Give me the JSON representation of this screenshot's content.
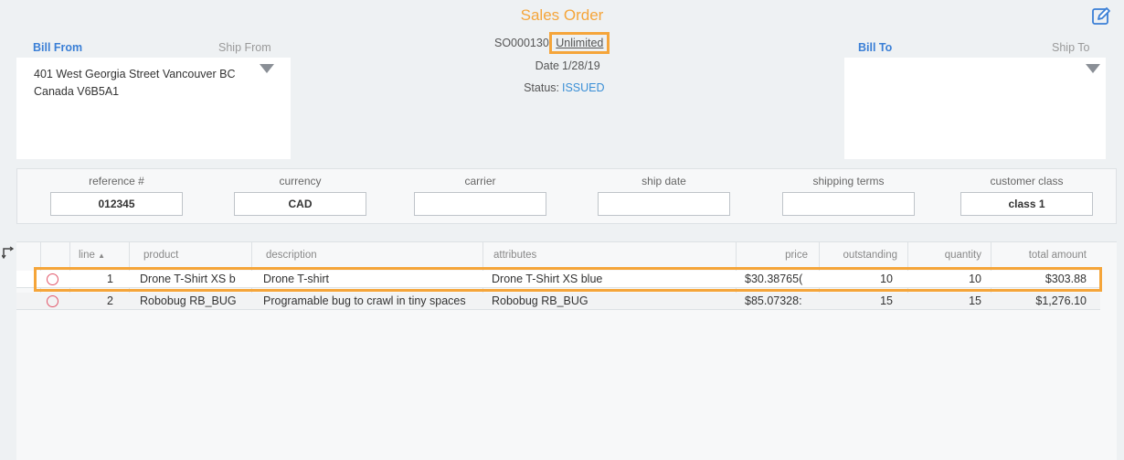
{
  "header": {
    "title": "Sales Order",
    "order_prefix": "SO000130:",
    "order_link": "Unlimited",
    "date_label": "Date",
    "date_value": "1/28/19",
    "status_label": "Status:",
    "status_value": "ISSUED"
  },
  "left_panel": {
    "tab_primary": "Bill From",
    "tab_secondary": "Ship From",
    "address_line1": "401 West Georgia Street Vancouver BC",
    "address_line2": "Canada V6B5A1"
  },
  "right_panel": {
    "tab_primary": "Bill To",
    "tab_secondary": "Ship To"
  },
  "fields": [
    {
      "label": "reference #",
      "value": "012345"
    },
    {
      "label": "currency",
      "value": "CAD"
    },
    {
      "label": "carrier",
      "value": ""
    },
    {
      "label": "ship date",
      "value": ""
    },
    {
      "label": "shipping terms",
      "value": ""
    },
    {
      "label": "customer class",
      "value": "class 1"
    }
  ],
  "table": {
    "columns": [
      "line",
      "product",
      "description",
      "attributes",
      "price",
      "outstanding",
      "quantity",
      "total amount"
    ],
    "sort_indicator": "▲",
    "rows": [
      {
        "line": "1",
        "product": "Drone T-Shirt XS b",
        "description": "Drone T-shirt",
        "attributes": "Drone T-Shirt XS blue",
        "price": "$30.38765(",
        "outstanding": "10",
        "quantity": "10",
        "total": "$303.88"
      },
      {
        "line": "2",
        "product": "Robobug RB_BUG",
        "description": "Programable bug to crawl in tiny spaces",
        "attributes": "Robobug RB_BUG",
        "price": "$85.07328:",
        "outstanding": "15",
        "quantity": "15",
        "total": "$1,276.10"
      }
    ]
  },
  "colors": {
    "accent_orange": "#f5a53a",
    "link_blue": "#3a7fd6",
    "radio_red": "#e2566a"
  },
  "icons": {
    "edit": "edit-pencil-icon",
    "side": "expand-arrows-icon",
    "dropdown": "triangle-down-icon"
  }
}
